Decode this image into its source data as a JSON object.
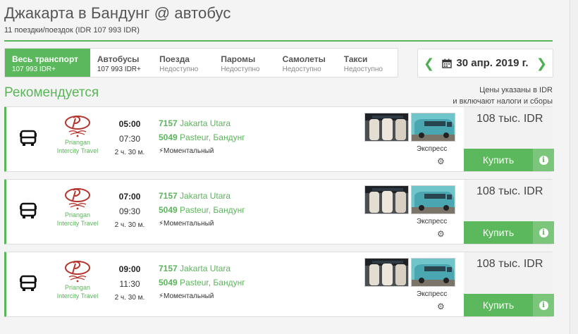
{
  "header": {
    "title": "Джакарта в Бандунг @ автобус",
    "subtitle": "11 поездки/поездок (IDR 107 993 IDR)"
  },
  "tabs": [
    {
      "name": "Весь транспорт",
      "value": "107 993 IDR+"
    },
    {
      "name": "Автобусы",
      "value": "107 993 IDR+"
    },
    {
      "name": "Поезда",
      "value": "Недоступно"
    },
    {
      "name": "Паромы",
      "value": "Недоступно"
    },
    {
      "name": "Самолеты",
      "value": "Недоступно"
    },
    {
      "name": "Такси",
      "value": "Недоступно"
    }
  ],
  "date": {
    "text": "30 апр. 2019 г.",
    "prev_icon": "chevron-left-icon",
    "next_icon": "chevron-right-icon",
    "calendar_icon": "calendar-icon"
  },
  "section": {
    "recommend": "Рекомендуется",
    "price_note_1": "Цены указаны в IDR",
    "price_note_2": "и включают налоги и сборы"
  },
  "trips": [
    {
      "operator_1": "Priangan",
      "operator_2": "Intercity Travel",
      "dep": "05:00",
      "arr": "07:30",
      "dur": "2 ч. 30 м.",
      "from_code": "7157",
      "from_name": " Jakarta Utara",
      "to_code": "5049",
      "to_name": " Pasteur, Бандунг",
      "instant": "Моментальный",
      "class": "Экспресс",
      "price": "108 тыс. IDR",
      "buy": "Купить"
    },
    {
      "operator_1": "Priangan",
      "operator_2": "Intercity Travel",
      "dep": "07:00",
      "arr": "09:30",
      "dur": "2 ч. 30 м.",
      "from_code": "7157",
      "from_name": " Jakarta Utara",
      "to_code": "5049",
      "to_name": " Pasteur, Бандунг",
      "instant": "Моментальный",
      "class": "Экспресс",
      "price": "108 тыс. IDR",
      "buy": "Купить"
    },
    {
      "operator_1": "Priangan",
      "operator_2": "Intercity Travel",
      "dep": "09:00",
      "arr": "11:30",
      "dur": "2 ч. 30 м.",
      "from_code": "7157",
      "from_name": " Jakarta Utara",
      "to_code": "5049",
      "to_name": " Pasteur, Бандунг",
      "instant": "Моментальный",
      "class": "Экспресс",
      "price": "108 тыс. IDR",
      "buy": "Купить"
    }
  ],
  "colors": {
    "accent": "#5cb85c",
    "accent_light": "#7bc67b",
    "logo_red": "#b5362f"
  }
}
